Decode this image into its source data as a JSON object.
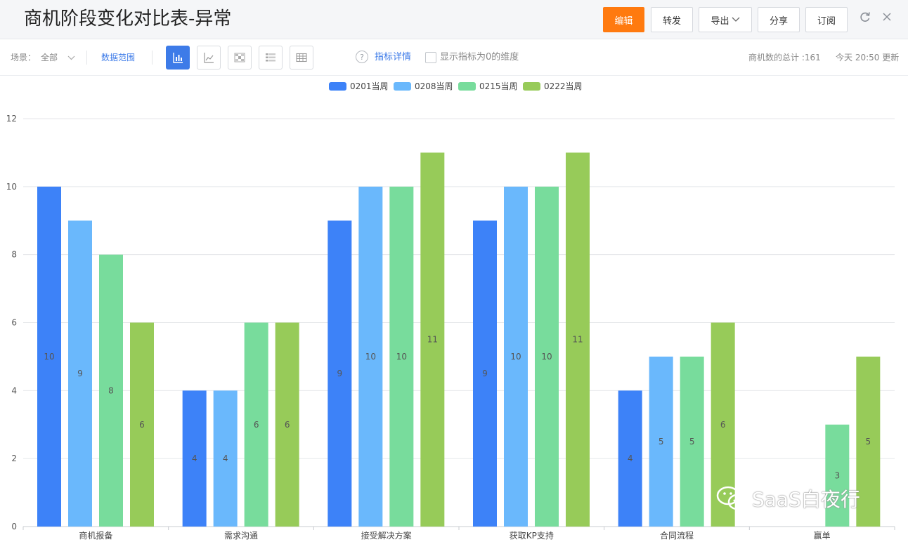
{
  "header": {
    "title": "商机阶段变化对比表-异常",
    "buttons": {
      "edit": "编辑",
      "forward": "转发",
      "export": "导出",
      "share": "分享",
      "subscribe": "订阅"
    }
  },
  "toolbar": {
    "scene_label": "场景：",
    "scene_value": "全部",
    "data_range": "数据范围",
    "metric_detail": "指标详情",
    "show_zero_label": "显示指标为0的维度",
    "total_text": "商机数的总计 :161",
    "updated_text": "今天 20:50 更新"
  },
  "colors": {
    "accent": "#ff7a0f",
    "link": "#3d7be8",
    "series": [
      "#3d82f8",
      "#6ab8fc",
      "#78dc9c",
      "#97cb59"
    ]
  },
  "chart_data": {
    "type": "bar",
    "categories": [
      "商机报备",
      "需求沟通",
      "接受解决方案",
      "获取KP支持",
      "合同流程",
      "赢单"
    ],
    "series": [
      {
        "name": "0201当周",
        "values": [
          10,
          4,
          9,
          9,
          4,
          null
        ]
      },
      {
        "name": "0208当周",
        "values": [
          9,
          4,
          10,
          10,
          5,
          null
        ]
      },
      {
        "name": "0215当周",
        "values": [
          8,
          6,
          10,
          10,
          5,
          3
        ]
      },
      {
        "name": "0222当周",
        "values": [
          6,
          6,
          11,
          11,
          6,
          5
        ]
      }
    ],
    "yticks": [
      0,
      2,
      4,
      6,
      8,
      10,
      12
    ],
    "ylim": [
      0,
      12
    ],
    "grid": true,
    "legend": "top-center",
    "data_labels": "inside-middle"
  },
  "watermark": {
    "text": "SaaS白夜行",
    "icon": "wechat-icon"
  }
}
